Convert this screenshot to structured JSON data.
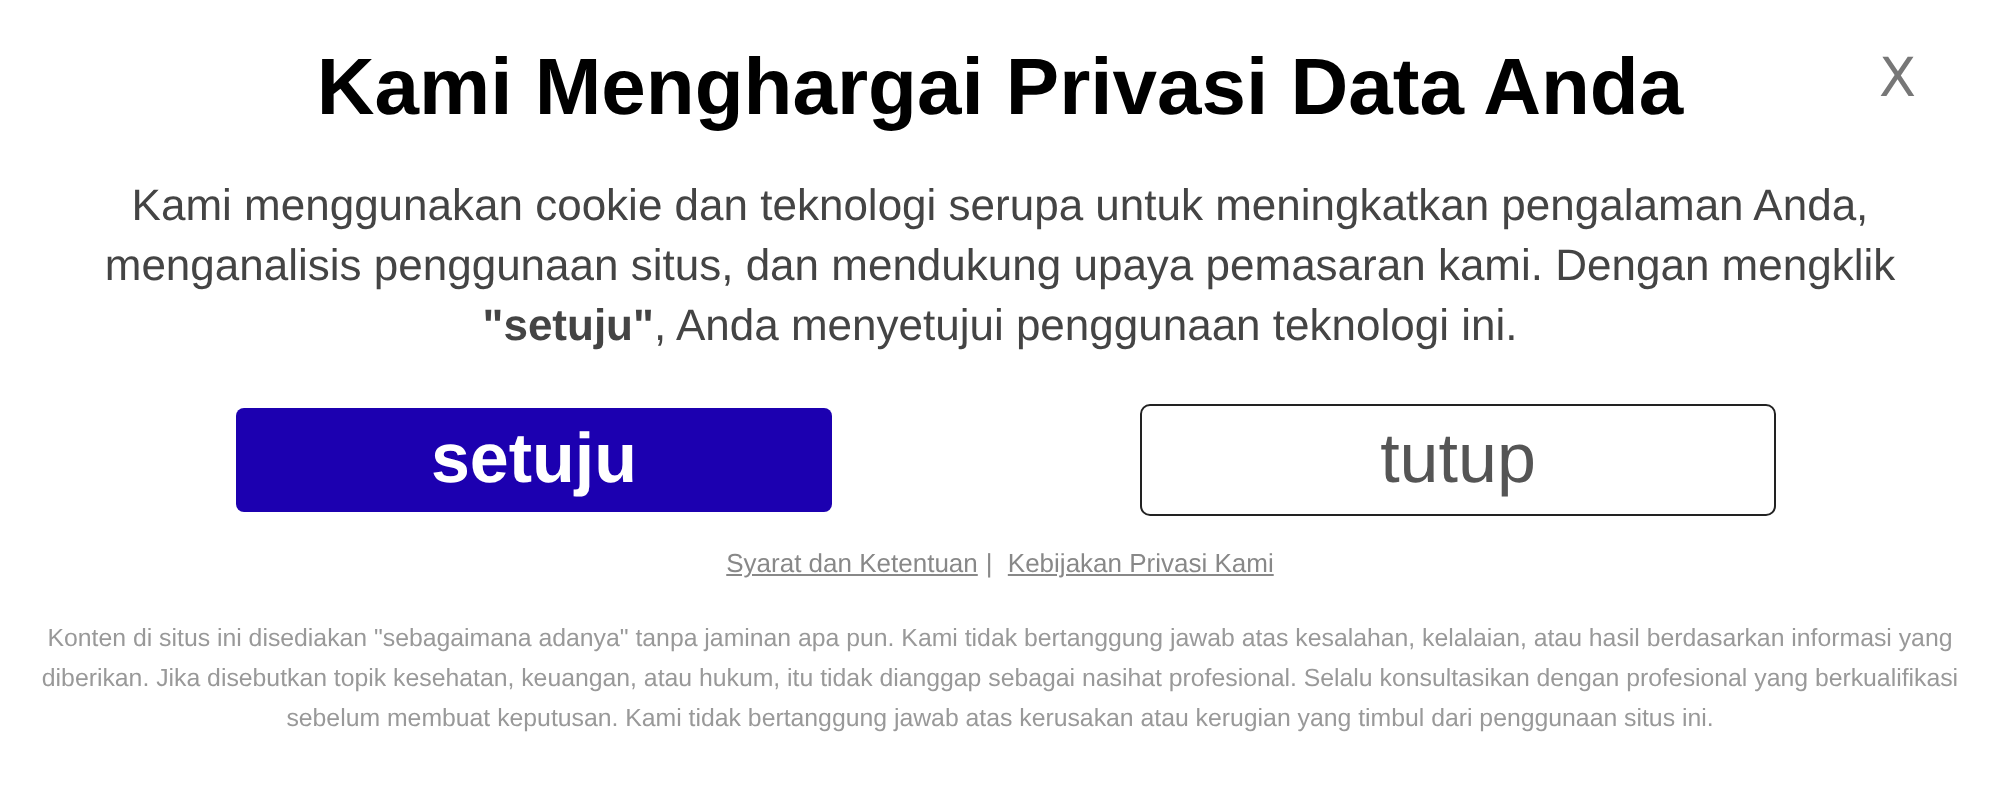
{
  "dialog": {
    "title": "Kami Menghargai Privasi Data Anda",
    "close": "X",
    "message": "Kami menggunakan cookie dan teknologi serupa untuk meningkatkan pengalaman Anda, menganalisis penggunaan situs, dan mendukung upaya pemasaran kami. Dengan mengklik **\"setuju\"**, Anda menyetujui penggunaan teknologi ini.",
    "buttons": [
      {
        "label": "setuju",
        "kind": "primary"
      },
      {
        "label": "tutup",
        "kind": "secondary"
      }
    ],
    "links": [
      {
        "label": "Syarat dan Ketentuan"
      },
      {
        "label": "Kebijakan Privasi Kami"
      }
    ],
    "link_separator": "|",
    "disclaimer": "Konten di situs ini disediakan \"sebagaimana adanya\" tanpa jaminan apa pun. Kami tidak bertanggung jawab atas kesalahan, kelalaian, atau hasil berdasarkan informasi yang diberikan. Jika disebutkan topik kesehatan, keuangan, atau hukum, itu tidak dianggap sebagai nasihat profesional. Selalu konsultasikan dengan profesional yang berkualifikasi sebelum membuat keputusan. Kami tidak bertanggung jawab atas kerusakan atau kerugian yang timbul dari penggunaan situs ini."
  }
}
